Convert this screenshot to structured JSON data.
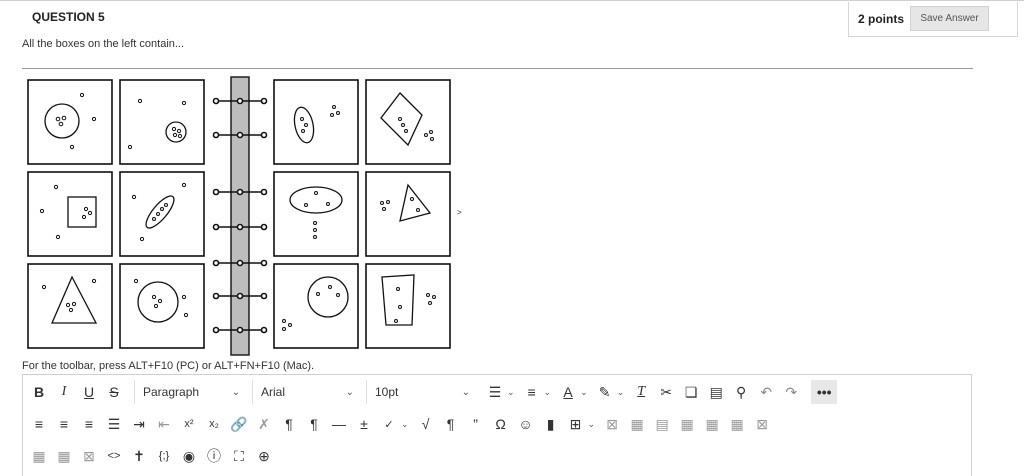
{
  "question": {
    "header": "QUESTION 5",
    "points": "2 points",
    "save_label": "Save Answer",
    "text": "All the boxes on the left contain...",
    "toolbar_hint": "For the toolbar, press ALT+F10 (PC) or ALT+FN+F10 (Mac)."
  },
  "editor": {
    "paragraph_label": "Paragraph",
    "font_label": "Arial",
    "size_label": "10pt",
    "more_label": "•••"
  },
  "icons": {
    "row1": [
      "bold-icon",
      "italic-icon",
      "underline-icon",
      "strikethrough-icon",
      "bullet-list-icon",
      "numbered-list-icon",
      "text-color-icon",
      "highlight-icon",
      "clear-format-icon",
      "cut-icon",
      "copy-icon",
      "paste-icon",
      "find-icon",
      "undo-icon",
      "redo-icon",
      "more-icon"
    ],
    "row2": [
      "align-left-icon",
      "align-center-icon",
      "align-right-icon",
      "justify-icon",
      "indent-icon",
      "outdent-icon",
      "superscript-icon",
      "subscript-icon",
      "link-icon",
      "unlink-icon",
      "ltr-icon",
      "rtl-icon",
      "horizontal-rule-icon",
      "plus-minus-icon",
      "spellcheck-icon",
      "math-icon",
      "paragraph-mark-icon",
      "blockquote-icon",
      "omega-icon",
      "emoji-icon",
      "bookmark-icon",
      "table-icon",
      "delete-table-icon",
      "table-props-icon",
      "table-row-icon",
      "row-before-icon",
      "row-after-icon",
      "col-before-icon",
      "delete-col-icon"
    ],
    "row3": [
      "merge-cells-icon",
      "split-cells-icon",
      "delete-cell-icon",
      "code-icon",
      "accessibility-icon",
      "html-icon",
      "preview-icon",
      "help-icon",
      "fullscreen-icon",
      "add-content-icon"
    ]
  }
}
